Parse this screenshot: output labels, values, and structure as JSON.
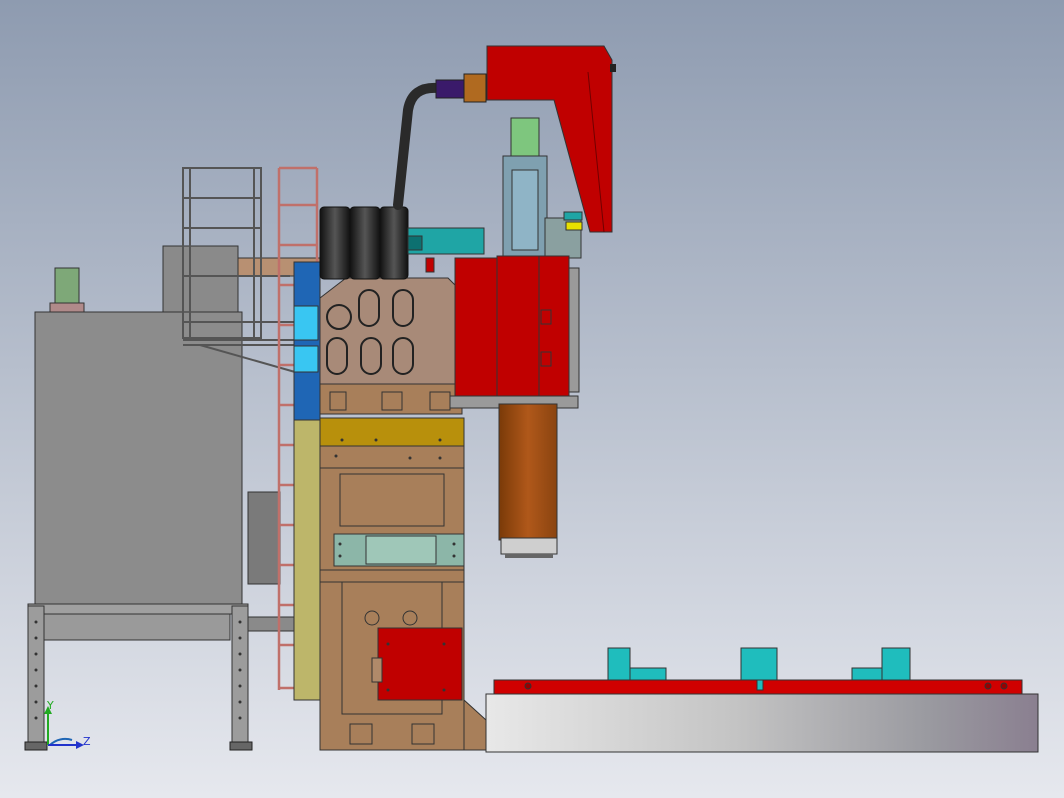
{
  "viewport": {
    "background_top": "#8e9bb0",
    "background_bottom": "#e6e8ee"
  },
  "triad": {
    "y_label": "Y",
    "z_label": "Z",
    "y_color": "#22aa22",
    "z_color": "#2233cc"
  },
  "colors": {
    "cabinet_gray": "#8c8c8c",
    "machine_red": "#c00000",
    "tan_body": "#a87f5a",
    "mustard": "#b8900c",
    "olive": "#bdb66a",
    "blue_panel": "#1f66b5",
    "cyan_panel": "#39c6f2",
    "teal": "#1fa5a5",
    "spindle_orange": "#a44e10",
    "table_gray": "#bfc1c3",
    "ladder_red": "#c0706a",
    "hose_dark": "#2a2a2a",
    "green_motor": "#7ec67e"
  }
}
